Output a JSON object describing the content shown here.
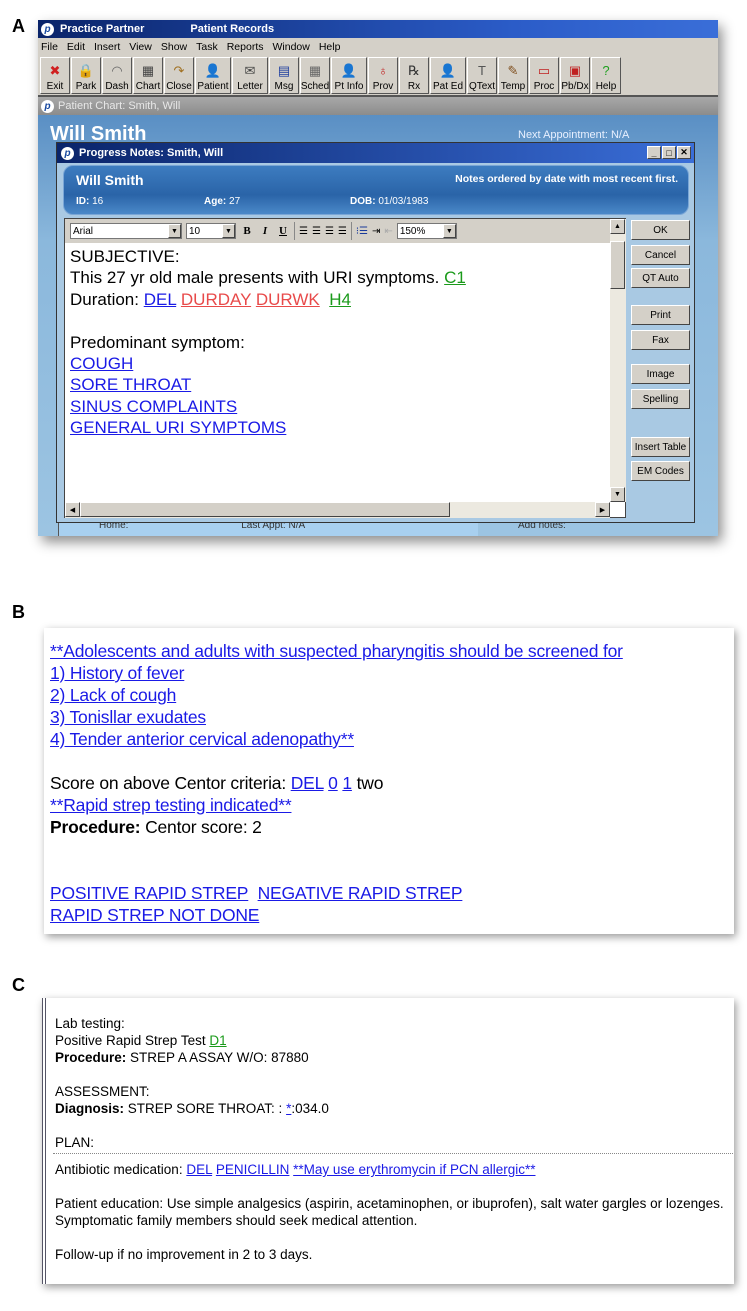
{
  "panels": {
    "a": "A",
    "b": "B",
    "c": "C"
  },
  "app": {
    "name": "Practice Partner",
    "module": "Patient Records"
  },
  "menu": [
    "File",
    "Edit",
    "Insert",
    "View",
    "Show",
    "Task",
    "Reports",
    "Window",
    "Help"
  ],
  "toolbar": [
    {
      "label": "Exit",
      "icon": "exit-icon",
      "glyph": "✖",
      "color": "#d02020"
    },
    {
      "label": "Park",
      "icon": "lock-icon",
      "glyph": "🔒",
      "color": "#888"
    },
    {
      "label": "Dash",
      "icon": "dashboard-icon",
      "glyph": "◠",
      "color": "#666"
    },
    {
      "label": "Chart",
      "icon": "chart-icon",
      "glyph": "▦",
      "color": "#444"
    },
    {
      "label": "Close",
      "icon": "close-chart-icon",
      "glyph": "↷",
      "color": "#a07020"
    },
    {
      "label": "Patient",
      "icon": "patient-icon",
      "glyph": "👤",
      "color": "#2050b0"
    },
    {
      "label": "Letter",
      "icon": "letter-icon",
      "glyph": "✉",
      "color": "#444"
    },
    {
      "label": "Msg",
      "icon": "message-icon",
      "glyph": "▤",
      "color": "#2040a0"
    },
    {
      "label": "Sched",
      "icon": "schedule-icon",
      "glyph": "▦",
      "color": "#666"
    },
    {
      "label": "Pt Info",
      "icon": "patient-info-icon",
      "glyph": "👤",
      "color": "#2050b0"
    },
    {
      "label": "Prov",
      "icon": "stethoscope-icon",
      "glyph": "♁",
      "color": "#c02020"
    },
    {
      "label": "Rx",
      "icon": "rx-icon",
      "glyph": "℞",
      "color": "#333"
    },
    {
      "label": "Pat Ed",
      "icon": "patient-education-icon",
      "glyph": "👤",
      "color": "#2050b0"
    },
    {
      "label": "QText",
      "icon": "quick-text-icon",
      "glyph": "T",
      "color": "#555"
    },
    {
      "label": "Temp",
      "icon": "template-icon",
      "glyph": "✎",
      "color": "#805020"
    },
    {
      "label": "Proc",
      "icon": "procedure-icon",
      "glyph": "▭",
      "color": "#c02020"
    },
    {
      "label": "Pb/Dx",
      "icon": "problem-diagnosis-icon",
      "glyph": "▣",
      "color": "#c02020"
    },
    {
      "label": "Help",
      "icon": "help-icon",
      "glyph": "?",
      "color": "#20a020"
    }
  ],
  "chart_window": {
    "title": "Patient Chart: Smith, Will",
    "patient_name": "Will Smith",
    "next_appointment": "Next Appointment: N/A",
    "home": "Home:",
    "last_appt": "Last Appt: N/A",
    "add_notes": "Add notes:"
  },
  "progress_notes": {
    "title": "Progress Notes: Smith, Will",
    "patient_name": "Will Smith",
    "order_note": "Notes ordered by date with most recent first.",
    "id_label": "ID:",
    "id": "16",
    "age_label": "Age:",
    "age": "27",
    "dob_label": "DOB:",
    "dob": "01/03/1983",
    "font": "Arial",
    "size": "10",
    "zoom": "150%",
    "buttons": [
      "OK",
      "Cancel",
      "QT Auto",
      "Print",
      "Fax",
      "Image",
      "Spelling",
      "Insert Table",
      "EM Codes"
    ],
    "text": {
      "subjective": "SUBJECTIVE:",
      "presents": "This 27 yr old male presents with URI symptoms.",
      "c1": "C1",
      "duration": "Duration:",
      "del": "DEL",
      "durday": "DURDAY",
      "durwk": "DURWK",
      "h4": "H4",
      "predominant": "Predominant symptom:",
      "symptoms": [
        "COUGH",
        "SORE THROAT",
        "SINUS COMPLAINTS",
        "GENERAL URI SYMPTOMS"
      ]
    }
  },
  "panel_b": {
    "intro": "**Adolescents and adults with suspected pharyngitis should be screened for",
    "criteria": [
      "1) History of fever",
      "2) Lack of cough",
      "3) Tonisllar exudates",
      "4) Tender anterior cervical adenopathy**"
    ],
    "score_label": "Score on above Centor criteria:",
    "score_links": [
      "DEL",
      "0",
      "1"
    ],
    "score_value": "two",
    "indicated": "**Rapid strep testing indicated**",
    "procedure_label": "Procedure:",
    "procedure": "Centor score: 2",
    "options": [
      "POSITIVE RAPID STREP",
      "NEGATIVE RAPID STREP",
      "RAPID STREP NOT DONE"
    ]
  },
  "panel_c": {
    "lab": "Lab testing:",
    "positive": "Positive Rapid Strep Test",
    "d1": "D1",
    "procedure_label": "Procedure:",
    "procedure": "STREP A ASSAY W/O: 87880",
    "assessment": "ASSESSMENT:",
    "diagnosis_label": "Diagnosis:",
    "diagnosis": "STREP SORE THROAT: :",
    "diag_link": "*",
    "diag_code": ":034.0",
    "plan": "PLAN:",
    "antibiotic_label": "Antibiotic medication:",
    "antibiotic_links": [
      "DEL",
      "PENICILLIN",
      "**May use erythromycin if PCN allergic**"
    ],
    "education": "Patient education: Use simple analgesics (aspirin, acetaminophen, or ibuprofen), salt water gargles or lozenges.  Symptomatic family members should seek medical attention.",
    "followup": "Follow-up if no improvement in 2 to 3 days."
  }
}
